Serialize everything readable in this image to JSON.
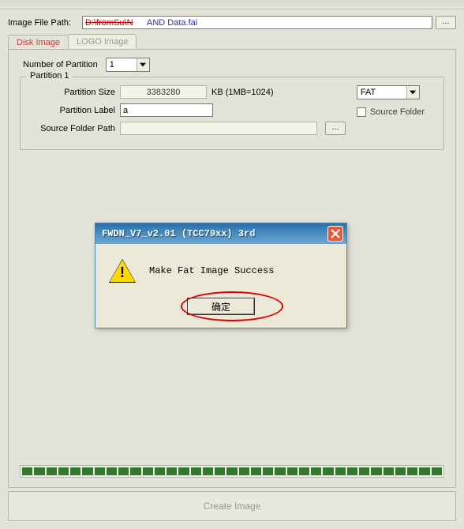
{
  "header": {
    "file_path_label": "Image File Path:",
    "file_path_value_strike": "D:\\fromSu\\N",
    "file_path_value_tail": "AND Data.fai",
    "browse_label": "..."
  },
  "tabs": {
    "disk": "Disk Image",
    "logo": "LOGO Image"
  },
  "partition": {
    "num_label": "Number of Partition",
    "num_value": "1",
    "group_title": "Partition 1",
    "size_label": "Partition Size",
    "size_value": "3383280",
    "size_unit": "KB (1MB=1024)",
    "label_label": "Partition Label",
    "label_value": "a",
    "path_label": "Source Folder Path",
    "path_value": "",
    "path_browse": "...",
    "fs_value": "FAT",
    "source_folder_chk": "Source Folder"
  },
  "dialog": {
    "title": "FWDN_V7_v2.01 (TCC79xx) 3rd",
    "message": "Make Fat Image Success",
    "ok_label": "确定"
  },
  "footer": {
    "create_label": "Create Image"
  }
}
